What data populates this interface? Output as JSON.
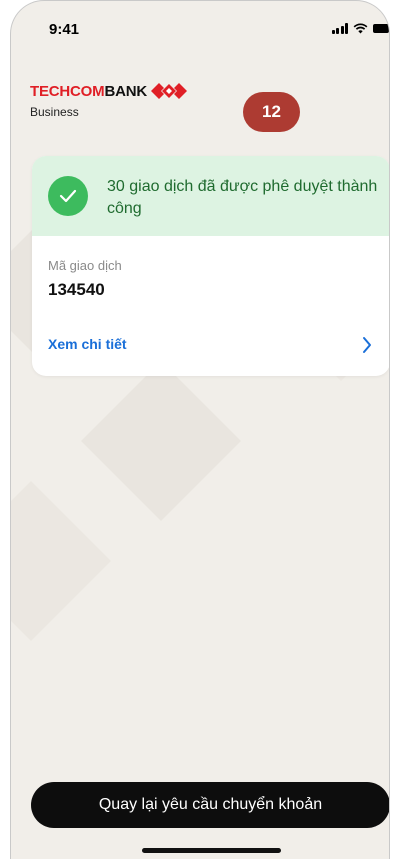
{
  "status_bar": {
    "time": "9:41",
    "icons": [
      "cellular-signal-icon",
      "wifi-icon",
      "battery-icon"
    ]
  },
  "brand": {
    "name_red": "TECHCOM",
    "name_black": "BANK",
    "subtitle": "Business",
    "logo_icon": "techcombank-diamond-logo",
    "red_color": "#e01f26"
  },
  "step_badge": {
    "number": "12",
    "color": "#ad3b32"
  },
  "result_card": {
    "status_icon": "check-circle-icon",
    "message": "30 giao dịch đã được phê duyệt thành công",
    "success_color": "#3dbb5e",
    "transaction_code_label": "Mã giao dịch",
    "transaction_code_value": "134540",
    "detail_link_label": "Xem chi tiết",
    "detail_link_icon": "chevron-right-icon",
    "link_color": "#1a6fd8"
  },
  "footer": {
    "primary_button_label": "Quay lại yêu cầu chuyển khoản"
  }
}
